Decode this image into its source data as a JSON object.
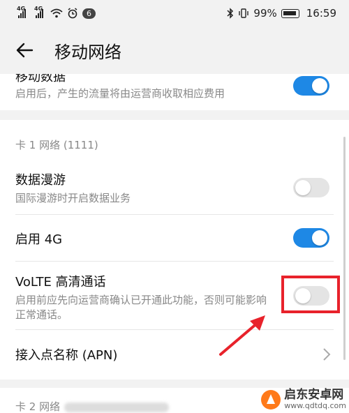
{
  "status_bar": {
    "sim1": "4G",
    "sim2": "4G",
    "notif_count": "6",
    "battery": "99%",
    "time": "16:59"
  },
  "header": {
    "title": "移动网络"
  },
  "mobile_data": {
    "title": "移动数据",
    "subtitle": "启用后，产生的流量将由运营商收取相应费用",
    "enabled": true
  },
  "sim1_section": {
    "label": "卡 1 网络 (1111)",
    "items": [
      {
        "title": "数据漫游",
        "subtitle": "国际漫游时开启数据业务",
        "enabled": false
      },
      {
        "title": "启用 4G",
        "enabled": true
      },
      {
        "title": "VoLTE 高清通话",
        "subtitle": "启用前应先向运营商确认已开通此功能，否则可能影响正常通话。",
        "enabled": false
      },
      {
        "title": "接入点名称 (APN)"
      }
    ]
  },
  "sim2_section": {
    "label": "卡 2 网络"
  },
  "watermark": {
    "name": "启东安卓网",
    "url": "www.qdtdq.com"
  },
  "colors": {
    "accent": "#1e88e5",
    "highlight": "#e8222b"
  }
}
